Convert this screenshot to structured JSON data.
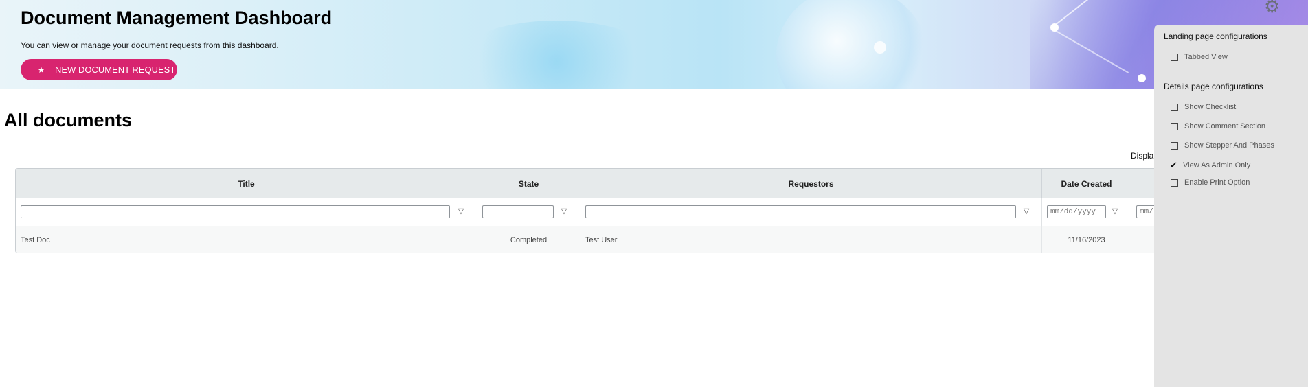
{
  "header": {
    "title": "Document Management Dashboard",
    "subtitle": "You can view or manage your document requests from this dashboard.",
    "new_request_label": "NEW DOCUMENT REQUEST",
    "new_request_icon": "star-icon",
    "settings_icon": "gear-icon"
  },
  "main": {
    "title": "All documents",
    "display_label": "Displa"
  },
  "grid": {
    "columns": [
      "Title",
      "State",
      "Requestors",
      "Date Created"
    ],
    "filters": {
      "date_placeholder": "mm/dd/yyyy",
      "date_placeholder_cut": "mm/"
    },
    "rows": [
      {
        "title": "Test Doc",
        "state": "Completed",
        "requestors": "Test User",
        "date_created": "11/16/2023"
      }
    ]
  },
  "settings_panel": {
    "landing_heading": "Landing page configurations",
    "landing_options": [
      {
        "label": "Tabbed View",
        "checked": false
      }
    ],
    "details_heading": "Details page configurations",
    "details_options": [
      {
        "label": "Show Checklist",
        "checked": false
      },
      {
        "label": "Show Comment Section",
        "checked": false
      },
      {
        "label": "Show Stepper And Phases",
        "checked": false
      },
      {
        "label": "View As Admin Only",
        "checked": true
      },
      {
        "label": "Enable Print Option",
        "checked": false
      }
    ]
  },
  "colors": {
    "accent": "#d8246f",
    "panel_bg": "#e4e4e4",
    "grid_header_bg": "#e6eaeb"
  }
}
